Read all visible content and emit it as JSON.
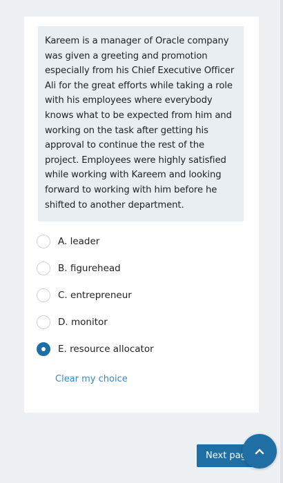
{
  "question": {
    "text": "Kareem is a manager of Oracle company was given a greeting and promotion especially from his Chief Executive Officer Ali for the great efforts while taking a role with his employees where everybody knows what to be expected from him and working on the task after getting his approval to continue the rest of the project.  Employees were highly satisfied while working with Kareem and looking forward to working with him before he shifted to another department."
  },
  "options": [
    {
      "label": "A. leader",
      "selected": false
    },
    {
      "label": "B. figurehead",
      "selected": false
    },
    {
      "label": "C. entrepreneur",
      "selected": false
    },
    {
      "label": "D. monitor",
      "selected": false
    },
    {
      "label": "E. resource allocator",
      "selected": true
    }
  ],
  "clear_choice_label": "Clear my choice",
  "next_page_label": "Next pag",
  "icons": {
    "scroll_top": "chevron-up-icon"
  },
  "colors": {
    "accent": "#1f6fa5",
    "link": "#3b87c4",
    "question_bg": "#e9eef3",
    "page_bg": "#eef1f4"
  }
}
